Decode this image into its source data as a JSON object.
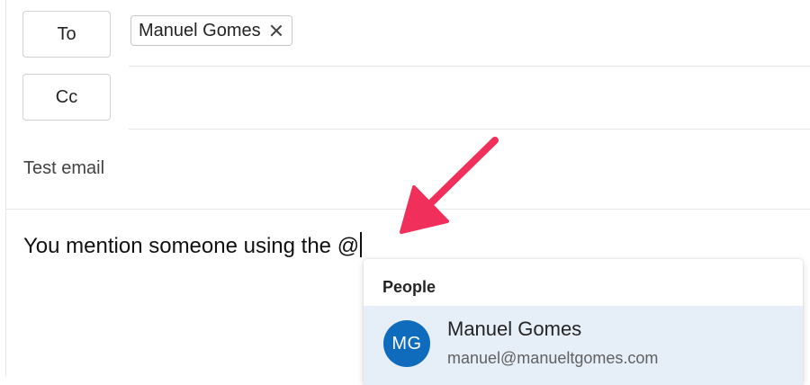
{
  "compose": {
    "to_label": "To",
    "cc_label": "Cc",
    "to_recipients": [
      {
        "name": "Manuel Gomes"
      }
    ],
    "subject": "Test email",
    "body": "You mention someone using the @"
  },
  "mention_popup": {
    "header": "People",
    "suggestions": [
      {
        "initials": "MG",
        "name": "Manuel Gomes",
        "email": "manuel@manueltgomes.com"
      }
    ]
  },
  "colors": {
    "arrow": "#f0305a",
    "avatar": "#0f6cbd",
    "suggestion_highlight": "#e6eef8"
  }
}
